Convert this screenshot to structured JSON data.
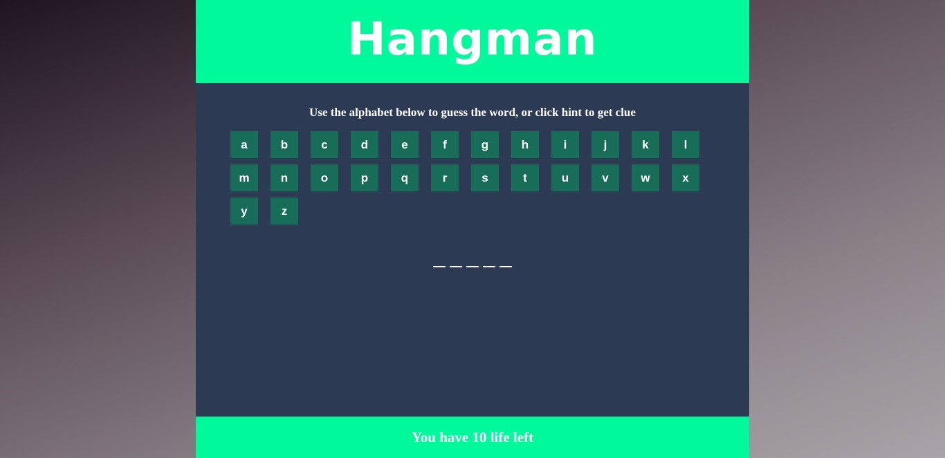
{
  "header": {
    "title": "Hangman"
  },
  "instructions": "Use the alphabet below to guess the word, or click hint to get clue",
  "alphabet": [
    "a",
    "b",
    "c",
    "d",
    "e",
    "f",
    "g",
    "h",
    "i",
    "j",
    "k",
    "l",
    "m",
    "n",
    "o",
    "p",
    "q",
    "r",
    "s",
    "t",
    "u",
    "v",
    "w",
    "x",
    "y",
    "z"
  ],
  "word": {
    "blank_count": 5
  },
  "footer": {
    "lives_text": "You have 10 life left"
  },
  "colors": {
    "header_bg": "#00fa9b",
    "board_bg": "#2d3a54",
    "letter_bg": "#176d57",
    "text": "#ffffff"
  }
}
